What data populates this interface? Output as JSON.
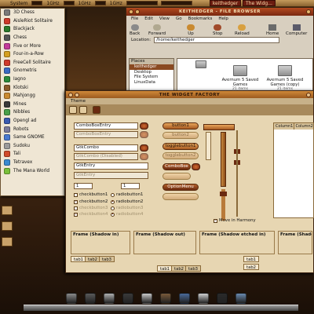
{
  "top_panel": {
    "app_label": "",
    "system_label": "System",
    "monitors": [
      "1GHz",
      "1GHz",
      "1GHz"
    ],
    "tasks": [
      "keithedger",
      "The Widg..."
    ]
  },
  "games_menu": {
    "items": [
      {
        "label": "3D Chess",
        "color": "#7a7a7a"
      },
      {
        "label": "AisleRiot Solitaire",
        "color": "#cf3a2a"
      },
      {
        "label": "Blackjack",
        "color": "#2a7a2a"
      },
      {
        "label": "Chess",
        "color": "#555555"
      },
      {
        "label": "Five or More",
        "color": "#c33a9a"
      },
      {
        "label": "Four-in-a-Row",
        "color": "#d5a020"
      },
      {
        "label": "FreeCell Solitaire",
        "color": "#cf3a2a"
      },
      {
        "label": "Gnometris",
        "color": "#3a6ac3"
      },
      {
        "label": "Iagno",
        "color": "#2a8a3a"
      },
      {
        "label": "Klotski",
        "color": "#8a5a2a"
      },
      {
        "label": "Mahjongg",
        "color": "#c98a30"
      },
      {
        "label": "Mines",
        "color": "#3a3a3a"
      },
      {
        "label": "Nibbles",
        "color": "#4aa04a"
      },
      {
        "label": "Opengl ad",
        "color": "#3a5ab0"
      },
      {
        "label": "Robots",
        "color": "#7a7a9a"
      },
      {
        "label": "Same GNOME",
        "color": "#4a7ad0"
      },
      {
        "label": "Sudoku",
        "color": "#9a9a9a"
      },
      {
        "label": "Tali",
        "color": "#d04a2a"
      },
      {
        "label": "Tetravex",
        "color": "#3a8ad0"
      },
      {
        "label": "The Mana World",
        "color": "#7ac03a"
      }
    ]
  },
  "file_browser": {
    "title": "KEITHEDGER - FILE BROWSER",
    "menu": [
      "File",
      "Edit",
      "View",
      "Go",
      "Bookmarks",
      "Help"
    ],
    "toolbar": [
      "Back",
      "Forward",
      "Up",
      "Stop",
      "Reload",
      "Home",
      "Computer"
    ],
    "location_label": "Location:",
    "location_value": "/home/keithedger",
    "places_label": "Places",
    "places": [
      "keithedger",
      "Desktop",
      "File System",
      "LinuxData"
    ],
    "folders": [
      {
        "name": "Avernum 5 Saved Games",
        "meta": "21 items"
      },
      {
        "name": "Avernum 5 Saved Games (copy)",
        "meta": "21 items"
      }
    ]
  },
  "widget_factory": {
    "title": "THE WIDGET FACTORY",
    "menu": "Theme",
    "combos": [
      {
        "label": "ComboBoxEntry",
        "disabled": false
      },
      {
        "label": "ComboBoxEntry",
        "disabled": true
      },
      {
        "label": "GtkCombo",
        "disabled": false
      },
      {
        "label": "GtkCombo (Disabled)",
        "disabled": true
      }
    ],
    "entries": [
      {
        "label": "GtkEntry",
        "disabled": false
      },
      {
        "label": "GtkEntry",
        "disabled": true
      }
    ],
    "spin_values": [
      "1",
      "1"
    ],
    "checks": [
      {
        "label": "checkbutton1",
        "checked": false
      },
      {
        "label": "checkbutton2",
        "checked": true
      },
      {
        "label": "checkbutton3",
        "checked": false
      },
      {
        "label": "checkbutton4",
        "checked": true
      }
    ],
    "radios": [
      {
        "label": "radiobutton1",
        "checked": false
      },
      {
        "label": "radiobutton2",
        "checked": true
      },
      {
        "label": "radiobutton3",
        "checked": false
      },
      {
        "label": "radiobutton4",
        "checked": true
      }
    ],
    "buttons": {
      "button1": "button1",
      "button2": "button2",
      "toggle1": "togglebutton1",
      "toggle2": "togglebutton2",
      "combo_box": "ComboBox",
      "combo_box2": "",
      "option_menu": "OptionMenu",
      "option_menu2": ""
    },
    "move_in_harmony": "Move in Harmony",
    "columns": [
      "Column1",
      "Column2"
    ],
    "frames": [
      "Frame (Shadow in)",
      "Frame (Shadow out)",
      "Frame (Shadow etched in)",
      "Frame (Shadow"
    ],
    "tabs": [
      "tab1",
      "tab2",
      "tab3"
    ]
  }
}
